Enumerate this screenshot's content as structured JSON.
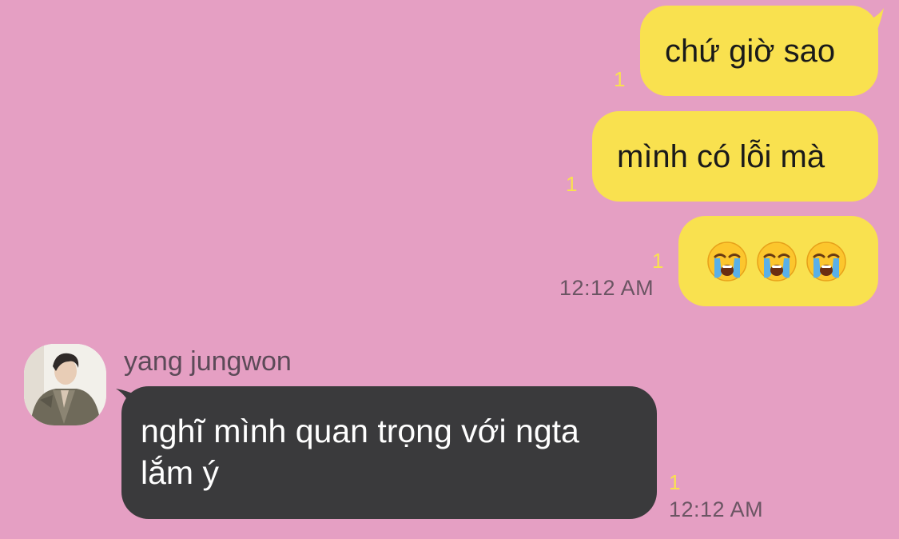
{
  "messages": {
    "sent_1": {
      "text": "chứ giờ sao",
      "unread": "1"
    },
    "sent_2": {
      "text": "mình có lỗi mà",
      "unread": "1"
    },
    "sent_3": {
      "emojis": [
        "loudly-crying-face",
        "loudly-crying-face",
        "loudly-crying-face"
      ],
      "unread": "1",
      "time": "12:12 AM"
    },
    "received_1": {
      "sender": "yang jungwon",
      "line1": "nghĩ mình quan trọng với ngta",
      "line2": "lắm ý",
      "unread": "1",
      "time": "12:12 AM"
    }
  },
  "colors": {
    "background": "#e59fc3",
    "sent_bubble": "#f9e14f",
    "received_bubble": "#3a3a3c",
    "unread_count": "#f9e14f"
  }
}
